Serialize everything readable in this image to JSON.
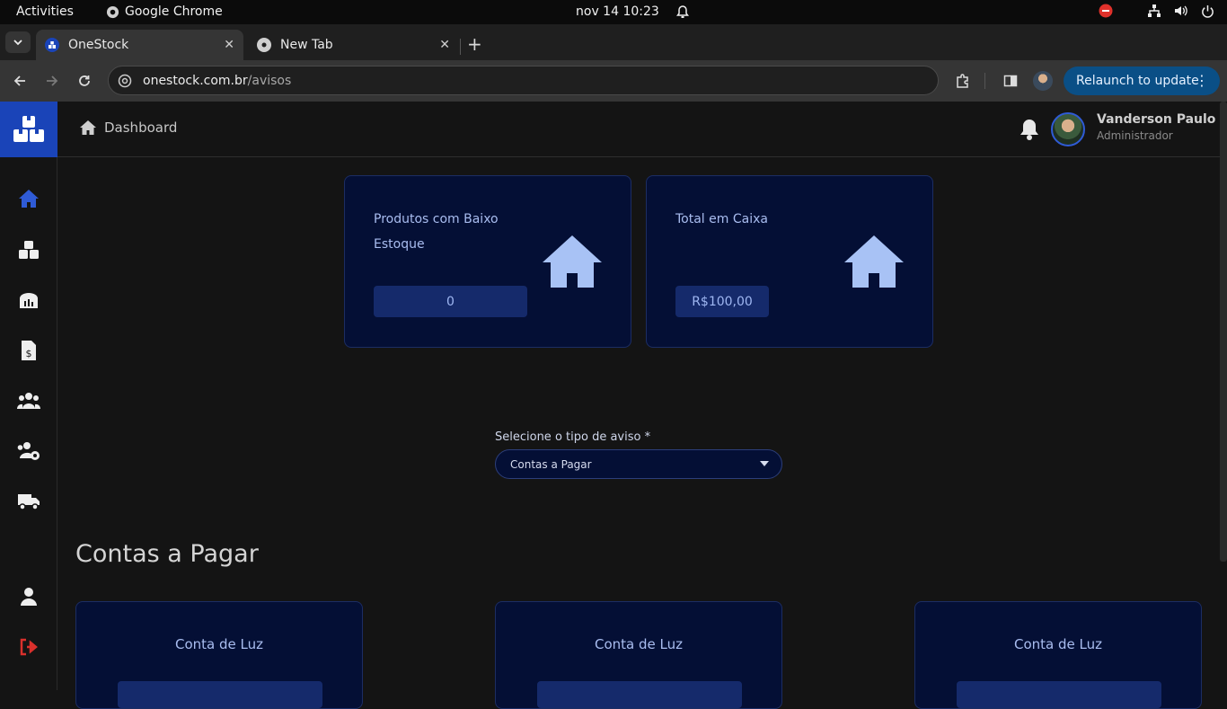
{
  "os": {
    "activities": "Activities",
    "app_name": "Google Chrome",
    "date": "nov 14",
    "time": "10:23"
  },
  "browser": {
    "tabs": [
      {
        "title": "OneStock",
        "active": true
      },
      {
        "title": "New Tab",
        "active": false
      }
    ],
    "url_host": "onestock.com.br",
    "url_path": "/avisos",
    "relaunch_label": "Relaunch to update"
  },
  "header": {
    "breadcrumb": "Dashboard",
    "user_name": "Vanderson Paulo",
    "user_role": "Administrador"
  },
  "summary_cards": [
    {
      "title_line1": "Produtos com Baixo",
      "title_line2": "Estoque",
      "value": "0"
    },
    {
      "title_line1": "Total em Caixa",
      "title_line2": "",
      "value": "R$100,00"
    }
  ],
  "notice_select": {
    "label": "Selecione o tipo de aviso *",
    "selected": "Contas a Pagar"
  },
  "section": {
    "title": "Contas a Pagar"
  },
  "bills": [
    {
      "title": "Conta de Luz"
    },
    {
      "title": "Conta de Luz"
    },
    {
      "title": "Conta de Luz"
    }
  ],
  "colors": {
    "brand": "#1a44b8",
    "card_bg": "#040f35",
    "accent_text": "#a9bdf0",
    "logout": "#d9302c"
  }
}
